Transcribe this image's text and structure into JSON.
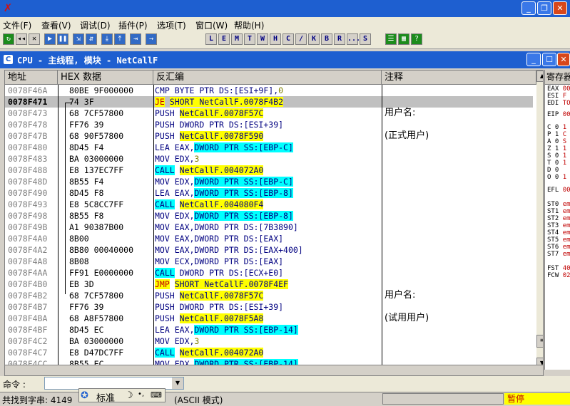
{
  "window": {
    "minimize_glyph": "_",
    "restore_glyph": "❐",
    "close_glyph": "✕"
  },
  "menu": [
    "文件(F)",
    "查看(V)",
    "调试(D)",
    "插件(P)",
    "选项(T)",
    "窗口(W)",
    "帮助(H)"
  ],
  "toolbar": {
    "letters": [
      "L",
      "E",
      "M",
      "T",
      "W",
      "H",
      "C",
      "/",
      "K",
      "B",
      "R",
      "...",
      "S"
    ]
  },
  "cpu_window": {
    "title": "CPU - 主线程, 模块 - NetCallF",
    "columns": {
      "address": "地址",
      "hex": "HEX 数据",
      "disasm": "反汇编",
      "comment": "注释"
    },
    "register_header": "寄存器"
  },
  "rows": [
    {
      "addr": "0078F46A",
      "hex": "80BE 9F000000",
      "op": "CMP",
      "op_style": "",
      "args": [
        {
          "t": "BYTE PTR DS:[ESI+9F],",
          "s": ""
        },
        {
          "t": "0",
          "s": "num"
        }
      ],
      "comment": ""
    },
    {
      "addr": "0078F471",
      "hex": "74 3F",
      "op": "JE",
      "op_style": "jmp",
      "args": [
        {
          "t": "SHORT NetCallF.0078F4B2",
          "s": "y"
        }
      ],
      "comment": "",
      "selected": true
    },
    {
      "addr": "0078F473",
      "hex": "68 7CF57800",
      "op": "PUSH",
      "op_style": "push",
      "args": [
        {
          "t": "NetCallF.0078F57C",
          "s": "y"
        }
      ],
      "comment": "用户名:"
    },
    {
      "addr": "0078F478",
      "hex": "FF76 39",
      "op": "PUSH",
      "op_style": "push",
      "args": [
        {
          "t": "DWORD PTR DS:[ESI+39]",
          "s": ""
        }
      ],
      "comment": ""
    },
    {
      "addr": "0078F47B",
      "hex": "68 90F57800",
      "op": "PUSH",
      "op_style": "push",
      "args": [
        {
          "t": "NetCallF.0078F590",
          "s": "y"
        }
      ],
      "comment": "(正式用户)"
    },
    {
      "addr": "0078F480",
      "hex": "8D45 F4",
      "op": "LEA",
      "op_style": "",
      "args": [
        {
          "t": "EAX,",
          "s": ""
        },
        {
          "t": "DWORD PTR SS:[EBP-C]",
          "s": "c"
        }
      ],
      "comment": ""
    },
    {
      "addr": "0078F483",
      "hex": "BA 03000000",
      "op": "MOV",
      "op_style": "",
      "args": [
        {
          "t": "EDX,",
          "s": ""
        },
        {
          "t": "3",
          "s": "num"
        }
      ],
      "comment": ""
    },
    {
      "addr": "0078F488",
      "hex": "E8 137EC7FF",
      "op": "CALL",
      "op_style": "call",
      "args": [
        {
          "t": "NetCallF.004072A0",
          "s": "y"
        }
      ],
      "comment": ""
    },
    {
      "addr": "0078F48D",
      "hex": "8B55 F4",
      "op": "MOV",
      "op_style": "",
      "args": [
        {
          "t": "EDX,",
          "s": ""
        },
        {
          "t": "DWORD PTR SS:[EBP-C]",
          "s": "c"
        }
      ],
      "comment": ""
    },
    {
      "addr": "0078F490",
      "hex": "8D45 F8",
      "op": "LEA",
      "op_style": "",
      "args": [
        {
          "t": "EAX,",
          "s": ""
        },
        {
          "t": "DWORD PTR SS:[EBP-8]",
          "s": "c"
        }
      ],
      "comment": ""
    },
    {
      "addr": "0078F493",
      "hex": "E8 5C8CC7FF",
      "op": "CALL",
      "op_style": "call",
      "args": [
        {
          "t": "NetCallF.004080F4",
          "s": "y"
        }
      ],
      "comment": ""
    },
    {
      "addr": "0078F498",
      "hex": "8B55 F8",
      "op": "MOV",
      "op_style": "",
      "args": [
        {
          "t": "EDX,",
          "s": ""
        },
        {
          "t": "DWORD PTR SS:[EBP-8]",
          "s": "c"
        }
      ],
      "comment": ""
    },
    {
      "addr": "0078F49B",
      "hex": "A1 90387B00",
      "op": "MOV",
      "op_style": "",
      "args": [
        {
          "t": "EAX,DWORD PTR DS:[7B3890]",
          "s": ""
        }
      ],
      "comment": ""
    },
    {
      "addr": "0078F4A0",
      "hex": "8B00",
      "op": "MOV",
      "op_style": "",
      "args": [
        {
          "t": "EAX,DWORD PTR DS:[EAX]",
          "s": ""
        }
      ],
      "comment": ""
    },
    {
      "addr": "0078F4A2",
      "hex": "8B80 00040000",
      "op": "MOV",
      "op_style": "",
      "args": [
        {
          "t": "EAX,DWORD PTR DS:[EAX+400]",
          "s": ""
        }
      ],
      "comment": ""
    },
    {
      "addr": "0078F4A8",
      "hex": "8B08",
      "op": "MOV",
      "op_style": "",
      "args": [
        {
          "t": "ECX,DWORD PTR DS:[EAX]",
          "s": ""
        }
      ],
      "comment": ""
    },
    {
      "addr": "0078F4AA",
      "hex": "FF91 E0000000",
      "op": "CALL",
      "op_style": "call",
      "args": [
        {
          "t": "DWORD PTR DS:[ECX+E0]",
          "s": ""
        }
      ],
      "comment": ""
    },
    {
      "addr": "0078F4B0",
      "hex": "EB 3D",
      "op": "JMP",
      "op_style": "jmp",
      "args": [
        {
          "t": "SHORT NetCallF.0078F4EF",
          "s": "y"
        }
      ],
      "comment": ""
    },
    {
      "addr": "0078F4B2",
      "hex": "68 7CF57800",
      "op": "PUSH",
      "op_style": "push",
      "args": [
        {
          "t": "NetCallF.0078F57C",
          "s": "y"
        }
      ],
      "comment": "用户名:"
    },
    {
      "addr": "0078F4B7",
      "hex": "FF76 39",
      "op": "PUSH",
      "op_style": "push",
      "args": [
        {
          "t": "DWORD PTR DS:[ESI+39]",
          "s": ""
        }
      ],
      "comment": ""
    },
    {
      "addr": "0078F4BA",
      "hex": "68 A8F57800",
      "op": "PUSH",
      "op_style": "push",
      "args": [
        {
          "t": "NetCallF.0078F5A8",
          "s": "y"
        }
      ],
      "comment": "(试用用户)"
    },
    {
      "addr": "0078F4BF",
      "hex": "8D45 EC",
      "op": "LEA",
      "op_style": "",
      "args": [
        {
          "t": "EAX,",
          "s": ""
        },
        {
          "t": "DWORD PTR SS:[EBP-14]",
          "s": "c"
        }
      ],
      "comment": ""
    },
    {
      "addr": "0078F4C2",
      "hex": "BA 03000000",
      "op": "MOV",
      "op_style": "",
      "args": [
        {
          "t": "EDX,",
          "s": ""
        },
        {
          "t": "3",
          "s": "num"
        }
      ],
      "comment": ""
    },
    {
      "addr": "0078F4C7",
      "hex": "E8 D47DC7FF",
      "op": "CALL",
      "op_style": "call",
      "args": [
        {
          "t": "NetCallF.004072A0",
          "s": "y"
        }
      ],
      "comment": ""
    },
    {
      "addr": "0078F4CC",
      "hex": "8B55 EC",
      "op": "MOV",
      "op_style": "",
      "args": [
        {
          "t": "EDX,",
          "s": ""
        },
        {
          "t": "DWORD PTR SS:[EBP-14]",
          "s": "c"
        }
      ],
      "comment": ""
    }
  ],
  "registers": [
    {
      "n": "EAX",
      "v": "00"
    },
    {
      "n": "ESI",
      "v": "F"
    },
    {
      "n": "EDI",
      "v": "TO"
    },
    {
      "n": "EIP",
      "v": "00"
    },
    {
      "n": "C 0",
      "v": "1"
    },
    {
      "n": "P 1",
      "v": "C"
    },
    {
      "n": "A 0",
      "v": "S"
    },
    {
      "n": "Z 1",
      "v": "1"
    },
    {
      "n": "S 0",
      "v": "1"
    },
    {
      "n": "T 0",
      "v": "1"
    },
    {
      "n": "D 0",
      "v": ""
    },
    {
      "n": "O 0",
      "v": "1"
    },
    {
      "n": "EFL",
      "v": "00"
    },
    {
      "n": "ST0",
      "v": "em"
    },
    {
      "n": "ST1",
      "v": "em"
    },
    {
      "n": "ST2",
      "v": "em"
    },
    {
      "n": "ST3",
      "v": "em"
    },
    {
      "n": "ST4",
      "v": "em"
    },
    {
      "n": "ST5",
      "v": "em"
    },
    {
      "n": "ST6",
      "v": "em"
    },
    {
      "n": "ST7",
      "v": "em"
    },
    {
      "n": "FST",
      "v": "40"
    },
    {
      "n": "FCW",
      "v": "02"
    }
  ],
  "command": {
    "label": "命令 :",
    "value": ""
  },
  "status": {
    "text": "共找到字串: 4149",
    "ime_label": "标准",
    "mode": "(ASCII 模式)",
    "state": "暂停"
  }
}
